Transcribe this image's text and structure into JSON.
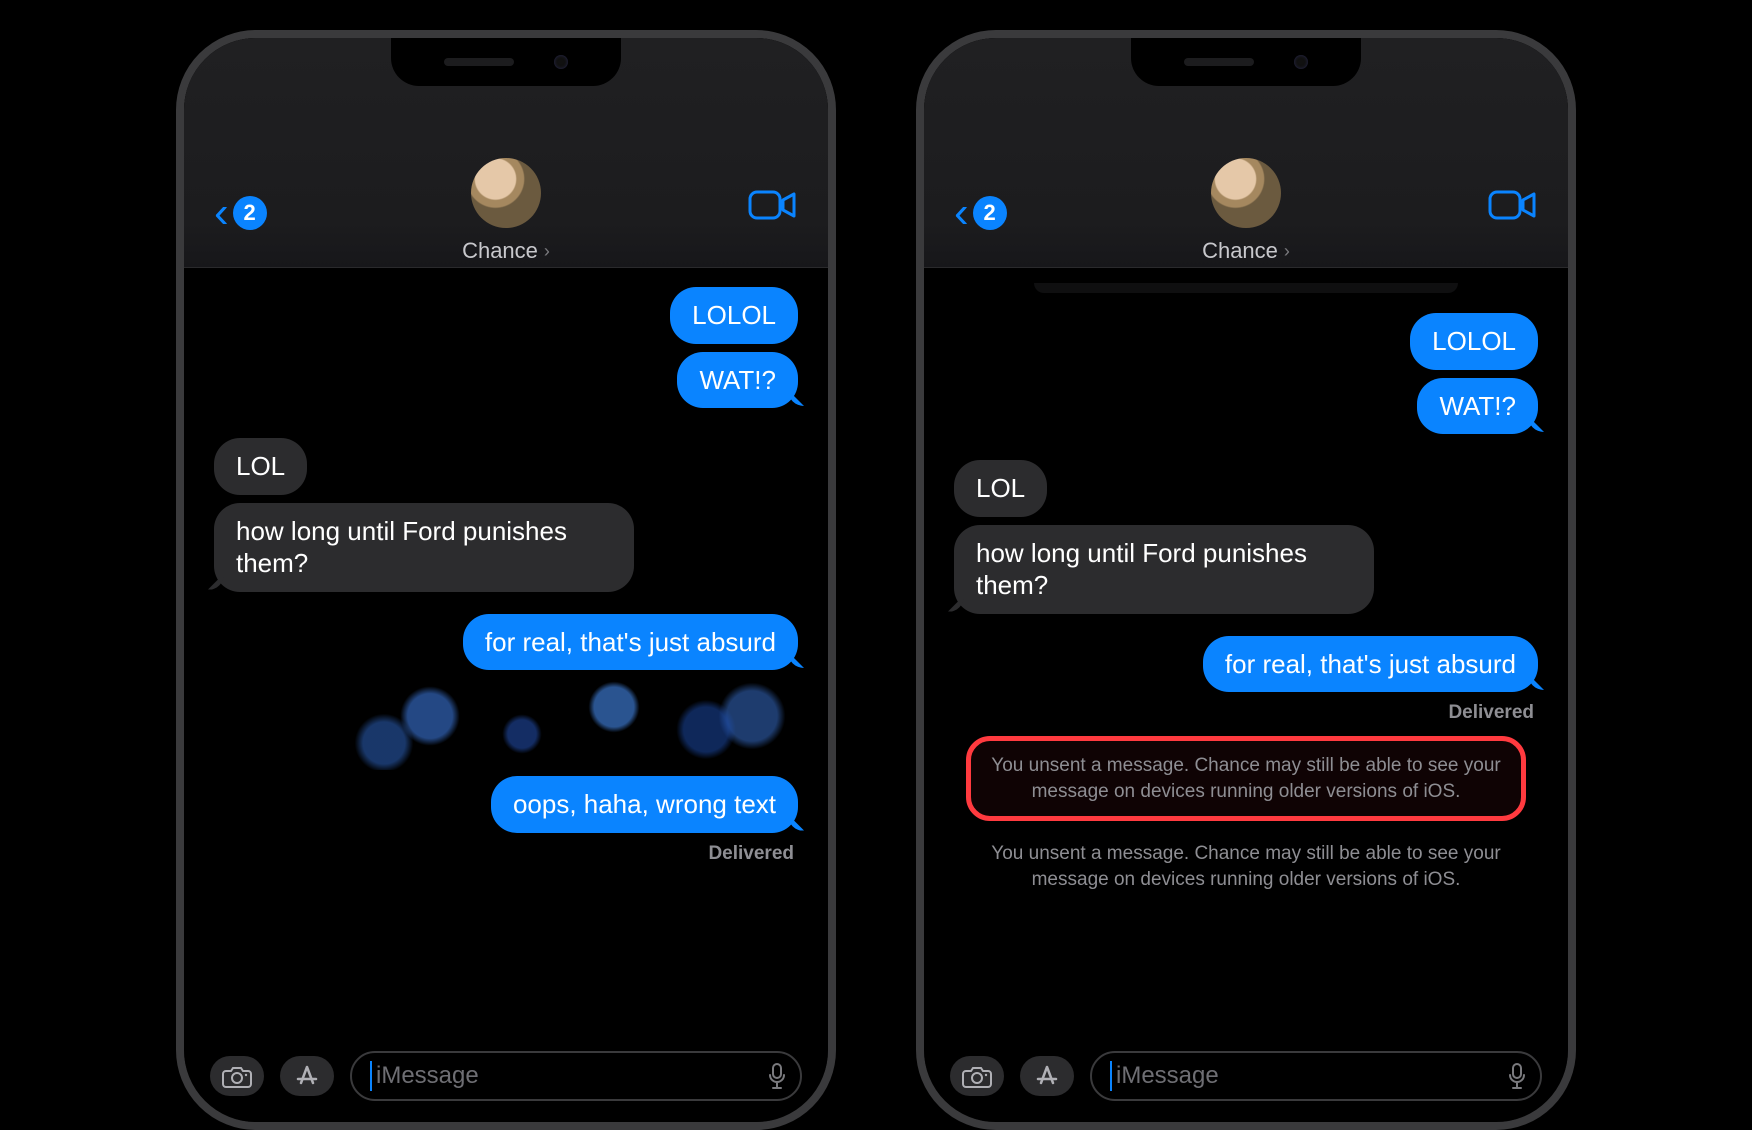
{
  "nav": {
    "back_count": "2",
    "contact_name": "Chance"
  },
  "composer": {
    "placeholder": "iMessage"
  },
  "phone_left": {
    "messages": {
      "m1": "LOLOL",
      "m2": "WAT!?",
      "m3": "LOL",
      "m4": "how long until Ford punishes them?",
      "m5": "for real, that's just absurd",
      "m6": "oops, haha, wrong text",
      "delivered": "Delivered"
    }
  },
  "phone_right": {
    "messages": {
      "m1": "LOLOL",
      "m2": "WAT!?",
      "m3": "LOL",
      "m4": "how long until Ford punishes them?",
      "m5": "for real, that's just absurd",
      "delivered": "Delivered",
      "unsent1": "You unsent a message. Chance may still be able to see your message on devices running older versions of iOS.",
      "unsent2": "You unsent a message. Chance may still be able to see your message on devices running older versions of iOS."
    }
  }
}
